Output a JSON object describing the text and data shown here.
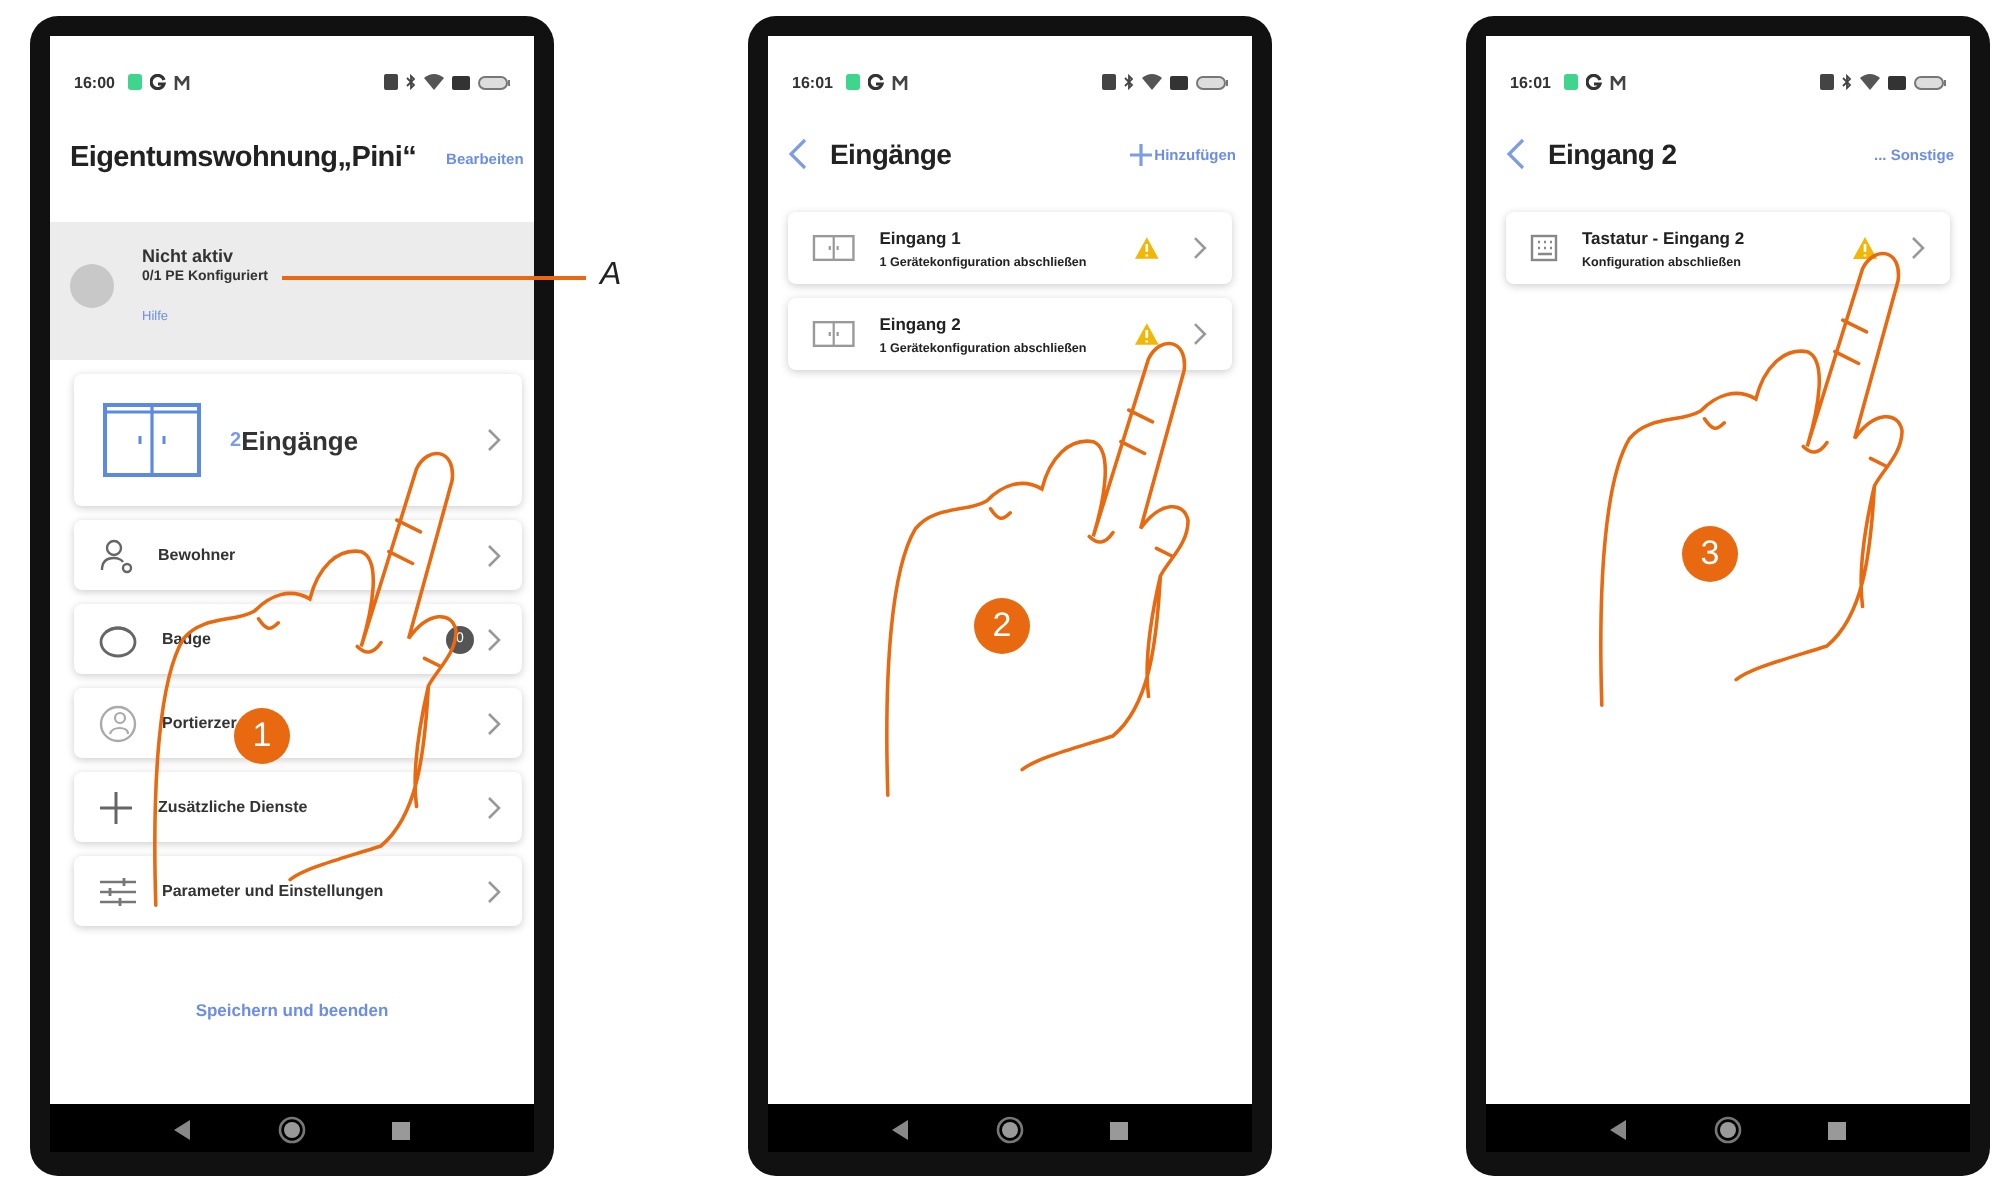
{
  "screens": [
    {
      "kind": "overview",
      "status_bar": {
        "time": "16:00"
      },
      "header": {
        "title": "Eigentumswohnung„Pini“",
        "kind": "edit",
        "action": "Bearbeiten"
      },
      "status_panel": {
        "title": "Nicht aktiv",
        "subtitle": "0/1 PE Konfiguriert",
        "link": "Hilfe",
        "callout": "A"
      },
      "summary_card": {
        "count": "2",
        "label": "Eingänge"
      },
      "menu": [
        {
          "kind": "person",
          "label": "Bewohner"
        },
        {
          "kind": "badge",
          "label": "Badge",
          "count": "0"
        },
        {
          "kind": "concierge",
          "label": "Portierzer"
        },
        {
          "kind": "plus",
          "label": "Zusätzliche Dienste"
        },
        {
          "kind": "sliders",
          "label": "Parameter und Einstellungen"
        }
      ],
      "footer_link": "Speichern und beenden",
      "step": "1"
    },
    {
      "kind": "list",
      "status_bar": {
        "time": "16:01"
      },
      "header": {
        "title": "Eingänge",
        "kind": "add",
        "back": true,
        "action": "Hinzufügen"
      },
      "items": [
        {
          "kind": "door",
          "title": "Eingang 1",
          "subtitle": "1 Gerätekonfiguration abschließen",
          "warning": true
        },
        {
          "kind": "door",
          "title": "Eingang 2",
          "subtitle": "1 Gerätekonfiguration abschließen",
          "warning": true
        }
      ],
      "step": "2"
    },
    {
      "kind": "list",
      "status_bar": {
        "time": "16:01"
      },
      "header": {
        "title": "Eingang 2",
        "kind": "more",
        "back": true,
        "action": "... Sonstige"
      },
      "items": [
        {
          "kind": "keypad",
          "title": "Tastatur - Eingang 2",
          "subtitle": "Konfiguration abschließen",
          "warning": true
        }
      ],
      "step": "3"
    }
  ]
}
